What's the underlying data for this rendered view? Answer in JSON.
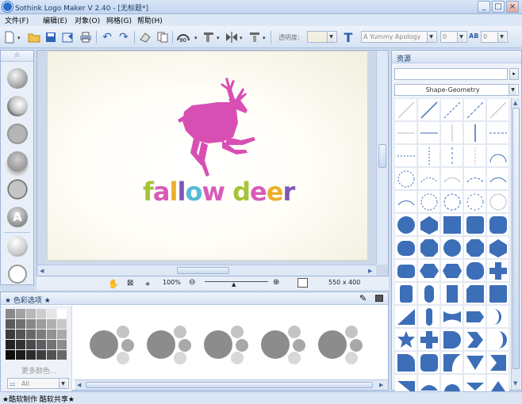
{
  "window": {
    "title": "Sothink Logo Maker V 2.40  - [无标题*]",
    "min": "_",
    "max": "□",
    "close": "×"
  },
  "menu": [
    {
      "label": "文件(F)"
    },
    {
      "label": "编辑(E)"
    },
    {
      "label": "对象(O)"
    },
    {
      "label": "网格(G)"
    },
    {
      "label": "帮助(H)"
    }
  ],
  "toolbar": {
    "transparency_label": "透明度:",
    "font_combo": "A Yummy Apology",
    "size_value": "0",
    "spacing_value": "0",
    "text_tool": "T",
    "spacing_icon": "AB"
  },
  "left_panel": {
    "tab": "☆"
  },
  "canvas": {
    "logo_text": "fallow deer",
    "logo_text_colors": [
      "#a5c43a",
      "#d85bb7",
      "#ecae2c",
      "#7f56b5",
      "#58b9d9",
      "#d85bb7"
    ],
    "deer_color": "#d84fb4"
  },
  "zoombar": {
    "zoom": "100%",
    "size": "550 x 400"
  },
  "color_panel": {
    "title": "★ 色彩选项 ★",
    "more_colors": "更多颜色...",
    "filter": "All",
    "swatches": [
      "#8a8a8a",
      "#a2a2a2",
      "#b8b8b8",
      "#cdcdcd",
      "#e5e5e5",
      "#ffffff",
      "#5a5a5a",
      "#707070",
      "#888",
      "#9c9c9c",
      "#b0b0b0",
      "#c8c8c8",
      "#3c3c3c",
      "#555",
      "#686868",
      "#7c7c7c",
      "#929292",
      "#aaaaaa",
      "#222",
      "#333",
      "#4a4a4a",
      "#5e5e5e",
      "#747474",
      "#8c8c8c",
      "#0e0e0e",
      "#1c1c1c",
      "#2c2c2c",
      "#3e3e3e",
      "#525252",
      "#686868"
    ]
  },
  "right_panel": {
    "title": "资源",
    "search_placeholder": "",
    "category": "Shape-Geometry",
    "shape_color": "#3d6eb8"
  },
  "status": {
    "text": "★酷软制作 酷软共享★"
  }
}
